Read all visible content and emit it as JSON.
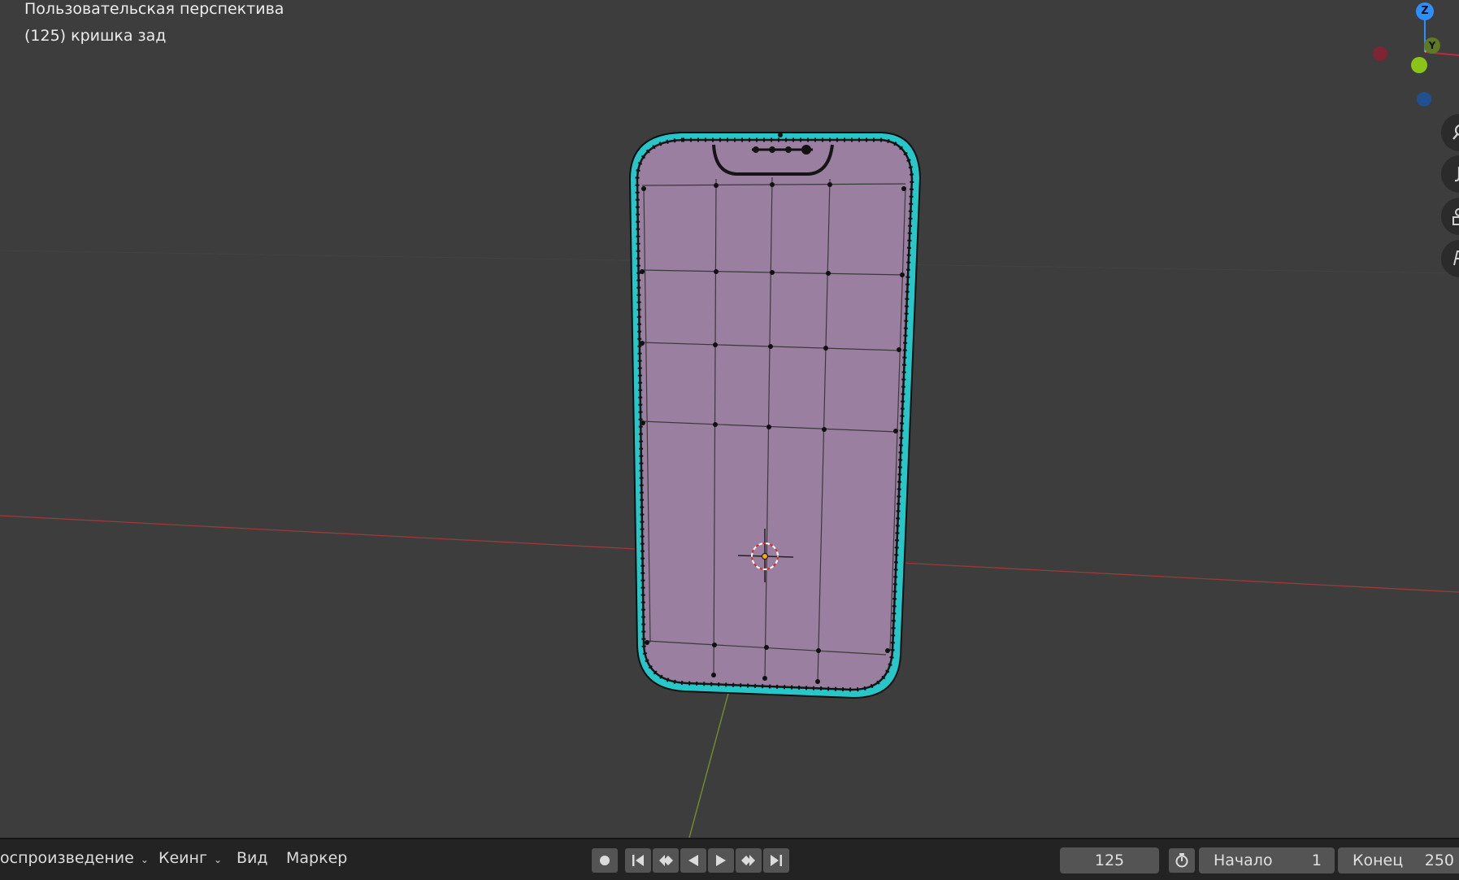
{
  "viewport": {
    "title": "Пользовательская перспектива",
    "object_info": "(125) кришка зад",
    "gizmo": {
      "z_label": "Z",
      "y_label": "Y",
      "colors": {
        "x": "#c4283e",
        "y": "#8ac419",
        "z": "#2c8fff"
      }
    },
    "nav_icons": [
      "zoom-icon",
      "hand-pan-icon",
      "camera-icon",
      "grid-ortho-icon"
    ],
    "mesh_colors": {
      "face": "#9a7fa0",
      "outline": "#27c6c9",
      "edges": "#151515"
    }
  },
  "timeline": {
    "menus": {
      "playback": "оспроизведение",
      "keying": "Кеинг",
      "view": "Вид",
      "marker": "Маркер"
    },
    "current_frame": "125",
    "start_label": "Начало",
    "start_value": "1",
    "end_label": "Конец",
    "end_value": "250"
  }
}
